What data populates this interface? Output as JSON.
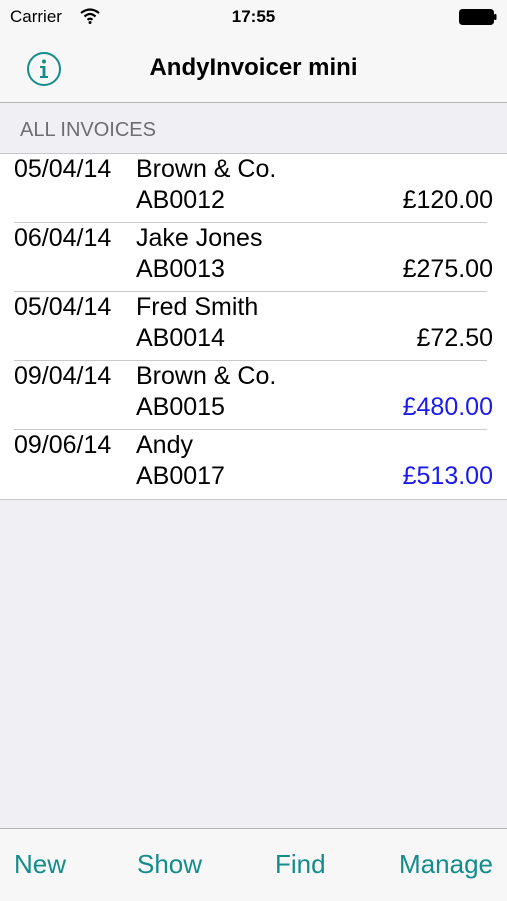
{
  "status_bar": {
    "carrier": "Carrier",
    "time": "17:55"
  },
  "nav": {
    "title": "AndyInvoicer mini",
    "info_icon": "info-circle-icon"
  },
  "section": {
    "header": "ALL INVOICES"
  },
  "invoices": [
    {
      "date": "05/04/14",
      "client": "Brown & Co.",
      "number": "AB0012",
      "amount": "£120.00",
      "highlight": false
    },
    {
      "date": "06/04/14",
      "client": "Jake Jones",
      "number": "AB0013",
      "amount": "£275.00",
      "highlight": false
    },
    {
      "date": "05/04/14",
      "client": "Fred Smith",
      "number": "AB0014",
      "amount": "£72.50",
      "highlight": false
    },
    {
      "date": "09/04/14",
      "client": "Brown & Co.",
      "number": "AB0015",
      "amount": "£480.00",
      "highlight": true
    },
    {
      "date": "09/06/14",
      "client": "Andy",
      "number": "AB0017",
      "amount": "£513.00",
      "highlight": true
    }
  ],
  "toolbar": {
    "new_label": "New",
    "show_label": "Show",
    "find_label": "Find",
    "manage_label": "Manage"
  },
  "colors": {
    "accent": "#148c8c",
    "highlight_amount": "#1a1af0",
    "background": "#efeff4"
  }
}
